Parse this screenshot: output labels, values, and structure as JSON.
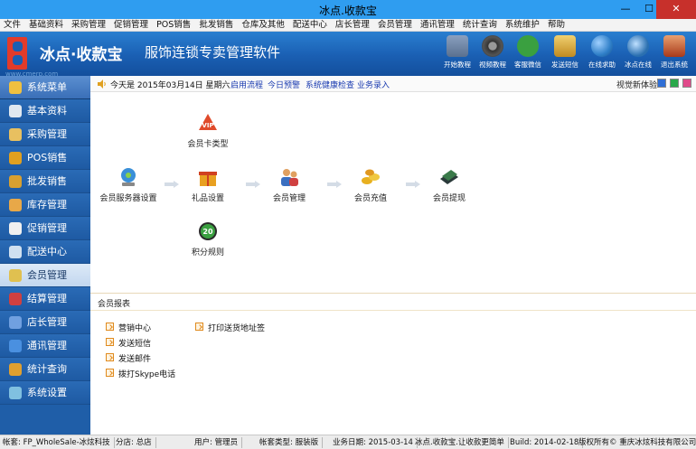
{
  "window": {
    "title": "冰点.收款宝",
    "minimize": "—",
    "maximize": "☐",
    "close": "✕"
  },
  "menu": [
    "文件",
    "基础资料",
    "采购管理",
    "促销管理",
    "POS销售",
    "批发销售",
    "仓库及其他",
    "配送中心",
    "店长管理",
    "会员管理",
    "通讯管理",
    "统计查询",
    "系统维护",
    "帮助"
  ],
  "banner": {
    "brand": "冰点·收款宝",
    "tagline": "服饰连锁专卖管理软件",
    "site": "www.cmerp.com",
    "tools": [
      {
        "label": "开始教程",
        "icon": "tutorial-icon",
        "color": "#6a7f9a"
      },
      {
        "label": "视频教程",
        "icon": "film-reel-icon",
        "color": "#444444"
      },
      {
        "label": "客服微信",
        "icon": "wechat-icon",
        "color": "#3aa040"
      },
      {
        "label": "发送短信",
        "icon": "sms-icon",
        "color": "#d6a93a"
      },
      {
        "label": "在线求助",
        "icon": "globe-icon",
        "color": "#2f7fc8"
      },
      {
        "label": "冰点在线",
        "icon": "person-globe-icon",
        "color": "#2a6fb0"
      },
      {
        "label": "退出系统",
        "icon": "exit-icon",
        "color": "#c84a2a"
      }
    ]
  },
  "sidebar": {
    "header": "系统菜单",
    "items": [
      {
        "label": "基本资料",
        "icon": "base-info-icon",
        "color": "#e0e8f0",
        "active": false
      },
      {
        "label": "采购管理",
        "icon": "purchase-icon",
        "color": "#e8c060",
        "active": false
      },
      {
        "label": "POS销售",
        "icon": "dollar-icon",
        "color": "#e0a020",
        "active": false
      },
      {
        "label": "批发销售",
        "icon": "wholesale-icon",
        "color": "#d8a030",
        "active": false
      },
      {
        "label": "库存管理",
        "icon": "warehouse-icon",
        "color": "#e8a848",
        "active": false
      },
      {
        "label": "促销管理",
        "icon": "promotion-icon",
        "color": "#f0f0f0",
        "active": false
      },
      {
        "label": "配送中心",
        "icon": "delivery-icon",
        "color": "#d0e0f0",
        "active": false
      },
      {
        "label": "会员管理",
        "icon": "member-icon",
        "color": "#e0c050",
        "active": true
      },
      {
        "label": "结算管理",
        "icon": "settlement-icon",
        "color": "#d04040",
        "active": false
      },
      {
        "label": "店长管理",
        "icon": "manager-icon",
        "color": "#70a0e0",
        "active": false
      },
      {
        "label": "通讯管理",
        "icon": "communication-icon",
        "color": "#4a90e0",
        "active": false
      },
      {
        "label": "统计查询",
        "icon": "statistics-icon",
        "color": "#e0a030",
        "active": false
      },
      {
        "label": "系统设置",
        "icon": "settings-icon",
        "color": "#80c0e0",
        "active": false
      }
    ]
  },
  "infobar": {
    "today": "今天是  2015年03月14日  星期六",
    "links": [
      "启用流程",
      "今日预警",
      "系统健康检查",
      "业务录入"
    ],
    "visual_label": "视觉新体验",
    "swatches": [
      "#2f6fd6",
      "#2aa84a",
      "#e04a8a"
    ]
  },
  "flow": {
    "nodes": {
      "card_type": {
        "label": "会员卡类型",
        "icon": "vip-card-icon"
      },
      "server": {
        "label": "会员服务器设置",
        "icon": "member-server-icon"
      },
      "gift": {
        "label": "礼品设置",
        "icon": "gift-icon"
      },
      "member": {
        "label": "会员管理",
        "icon": "members-icon"
      },
      "recharge": {
        "label": "会员充值",
        "icon": "coins-icon"
      },
      "withdraw": {
        "label": "会员提现",
        "icon": "cash-stack-icon"
      },
      "points": {
        "label": "积分规则",
        "icon": "points-badge-icon",
        "badge": "20"
      }
    }
  },
  "report": {
    "title": "会员报表",
    "links_col1": [
      "营销中心",
      "发送短信",
      "发送邮件",
      "拨打Skype电话"
    ],
    "links_col2": [
      "打印送货地址签"
    ]
  },
  "status": [
    "帐套: FP_WholeSale-冰炫科技",
    "分店: 总店",
    "用户: 管理员",
    "帐套类型: 服装版",
    "业务日期: 2015-03-14",
    "冰点.收款宝.让收款更简单",
    "Build: 2014-02-18",
    "版权所有© 重庆冰炫科技有限公司"
  ]
}
